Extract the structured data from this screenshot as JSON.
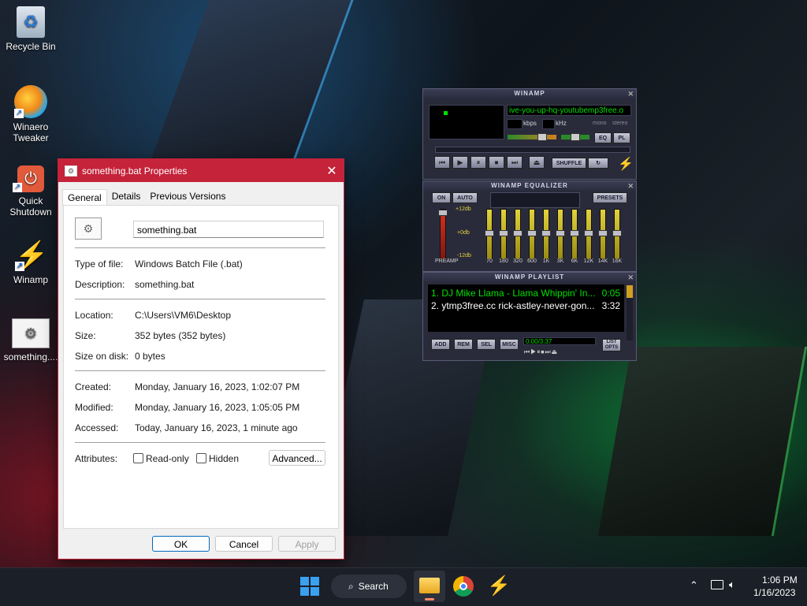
{
  "desktop": {
    "icons": [
      {
        "label": "Recycle Bin",
        "icon": "recycle-bin-icon"
      },
      {
        "label": "Winaero Tweaker",
        "icon": "winaero-tweaker-icon"
      },
      {
        "label": "Quick Shutdown",
        "icon": "quick-shutdown-icon"
      },
      {
        "label": "Winamp",
        "icon": "winamp-icon"
      },
      {
        "label": "something....",
        "icon": "batch-file-icon"
      }
    ]
  },
  "dialog": {
    "title": "something.bat Properties",
    "close_glyph": "✕",
    "tabs": [
      "General",
      "Details",
      "Previous Versions"
    ],
    "filename": "something.bat",
    "fields": {
      "type_label": "Type of file:",
      "type_value": "Windows Batch File (.bat)",
      "desc_label": "Description:",
      "desc_value": "something.bat",
      "location_label": "Location:",
      "location_value": "C:\\Users\\VM6\\Desktop",
      "size_label": "Size:",
      "size_value": "352 bytes (352 bytes)",
      "sizedisk_label": "Size on disk:",
      "sizedisk_value": "0 bytes",
      "created_label": "Created:",
      "created_value": "Monday, January 16, 2023, 1:02:07 PM",
      "modified_label": "Modified:",
      "modified_value": "Monday, January 16, 2023, 1:05:05 PM",
      "accessed_label": "Accessed:",
      "accessed_value": "Today, January 16, 2023, 1 minute ago",
      "attributes_label": "Attributes:"
    },
    "attributes": {
      "readonly": "Read-only",
      "hidden": "Hidden",
      "advanced": "Advanced..."
    },
    "buttons": {
      "ok": "OK",
      "cancel": "Cancel",
      "apply": "Apply"
    }
  },
  "winamp": {
    "title": "WINAMP",
    "marquee": "ive-you-up-hq-youtubemp3free.o",
    "kbps": "kbps",
    "khz": "kHz",
    "mono": "mono",
    "stereo": "stereo",
    "eq_btn": "EQ",
    "pl_btn": "PL",
    "shuffle": "SHUFFLE",
    "eq": {
      "title": "WINAMP EQUALIZER",
      "on": "ON",
      "auto": "AUTO",
      "presets": "PRESETS",
      "plus": "+12db",
      "zero": "+0db",
      "minus": "-12db",
      "preamp": "PREAMP",
      "bands": [
        "70",
        "180",
        "320",
        "600",
        "1K",
        "3K",
        "6K",
        "12K",
        "14K",
        "16K"
      ]
    },
    "playlist": {
      "title": "WINAMP PLAYLIST",
      "items": [
        {
          "text": "1. DJ Mike Llama - Llama Whippin' In...",
          "time": "0:05"
        },
        {
          "text": "2. ytmp3free.cc rick-astley-never-gon...",
          "time": "3:32"
        }
      ],
      "add": "ADD",
      "rem": "REM",
      "sel": "SEL",
      "misc": "MISC",
      "counter": "0:00/3:37",
      "list_opts": "LIST OPTS"
    }
  },
  "taskbar": {
    "search": "Search",
    "time": "1:06 PM",
    "date": "1/16/2023"
  },
  "colors": {
    "dialog_accent": "#c4233a",
    "winamp_green": "#00e000",
    "taskbar": "#1b1f27"
  }
}
